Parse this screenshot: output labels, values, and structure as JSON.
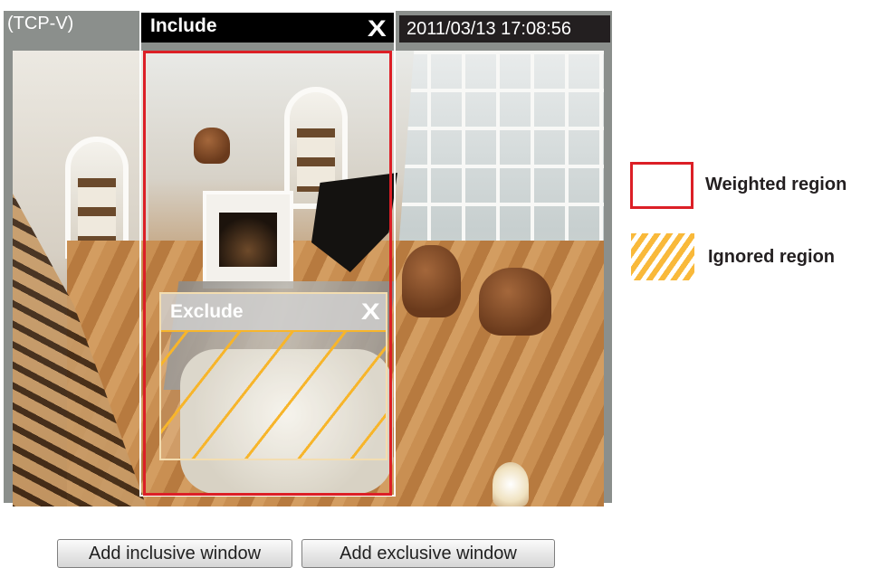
{
  "viewer": {
    "stream_label": "(TCP-V)",
    "timestamp": "2011/03/13  17:08:56"
  },
  "include_window": {
    "title": "Include",
    "close_label": "X"
  },
  "exclude_window": {
    "title": "Exclude",
    "close_label": "X"
  },
  "legend": {
    "weighted_label": "Weighted region",
    "ignored_label": "Ignored region"
  },
  "buttons": {
    "add_inclusive": "Add inclusive window",
    "add_exclusive": "Add exclusive window"
  },
  "colors": {
    "include_border": "#dc1f26",
    "exclude_hatch": "#f7b52b",
    "viewer_frame": "#8b8f8c",
    "timestamp_bg": "#231f20"
  },
  "icons": {
    "include_close": "close-icon",
    "exclude_close": "close-icon"
  }
}
